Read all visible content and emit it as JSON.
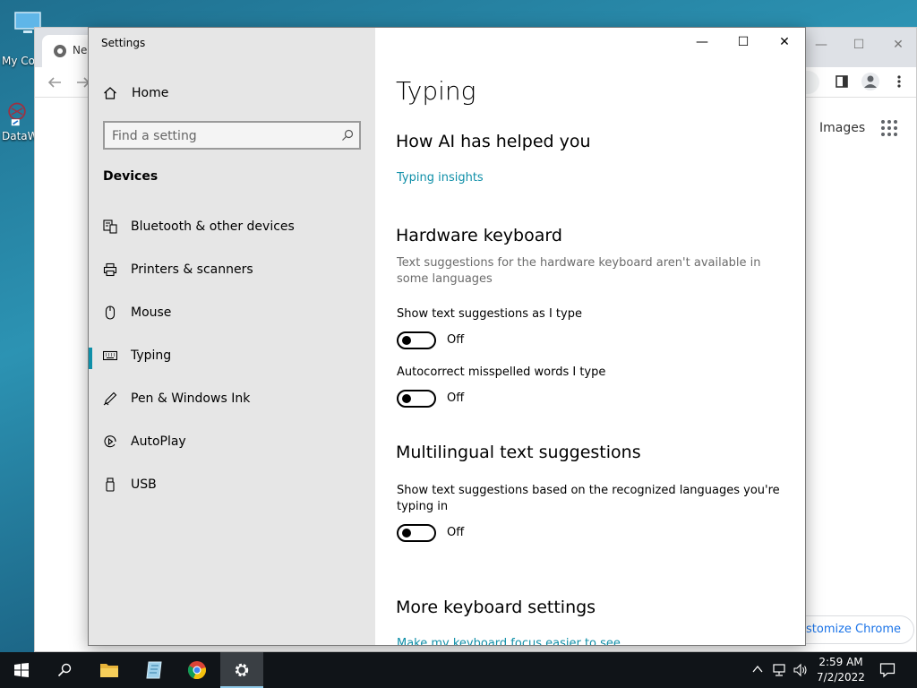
{
  "desktop": {
    "icons": [
      {
        "label": "My Co",
        "icon": "computer-icon"
      },
      {
        "label": "DataW",
        "icon": "app-shortcut-icon"
      }
    ]
  },
  "chrome": {
    "tab_title": "Ne",
    "images_link": "Images",
    "customize_label": "stomize Chrome",
    "controls": {
      "minimize": "—",
      "maximize": "☐",
      "close": "✕"
    }
  },
  "settings": {
    "window_title": "Settings",
    "controls": {
      "minimize": "—",
      "maximize": "☐",
      "close": "✕"
    },
    "nav": {
      "home_label": "Home",
      "search_placeholder": "Find a setting",
      "section": "Devices",
      "items": [
        {
          "label": "Bluetooth & other devices",
          "icon": "bluetooth-devices-icon",
          "active": false
        },
        {
          "label": "Printers & scanners",
          "icon": "printer-icon",
          "active": false
        },
        {
          "label": "Mouse",
          "icon": "mouse-icon",
          "active": false
        },
        {
          "label": "Typing",
          "icon": "keyboard-icon",
          "active": true
        },
        {
          "label": "Pen & Windows Ink",
          "icon": "pen-icon",
          "active": false
        },
        {
          "label": "AutoPlay",
          "icon": "autoplay-icon",
          "active": false
        },
        {
          "label": "USB",
          "icon": "usb-icon",
          "active": false
        }
      ]
    },
    "content": {
      "title": "Typing",
      "ai_heading": "How AI has helped you",
      "ai_link": "Typing insights",
      "hardware_heading": "Hardware keyboard",
      "hardware_desc": "Text suggestions for the hardware keyboard aren't available in some languages",
      "show_suggestions_label": "Show text suggestions as I type",
      "show_suggestions_state": "Off",
      "autocorrect_label": "Autocorrect misspelled words I type",
      "autocorrect_state": "Off",
      "multilingual_heading": "Multilingual text suggestions",
      "multilingual_label": "Show text suggestions based on the recognized languages you're typing in",
      "multilingual_state": "Off",
      "more_heading": "More keyboard settings",
      "more_link": "Make my keyboard focus easier to see"
    }
  },
  "taskbar": {
    "time": "2:59 AM",
    "date": "7/2/2022",
    "pinned": [
      "start-icon",
      "search-icon",
      "file-explorer-icon",
      "app-icon",
      "chrome-icon",
      "settings-gear-icon"
    ]
  },
  "colors": {
    "accent": "#0f8fa8",
    "nav_bg": "#e6e6e6",
    "taskbar_bg": "#101418"
  }
}
